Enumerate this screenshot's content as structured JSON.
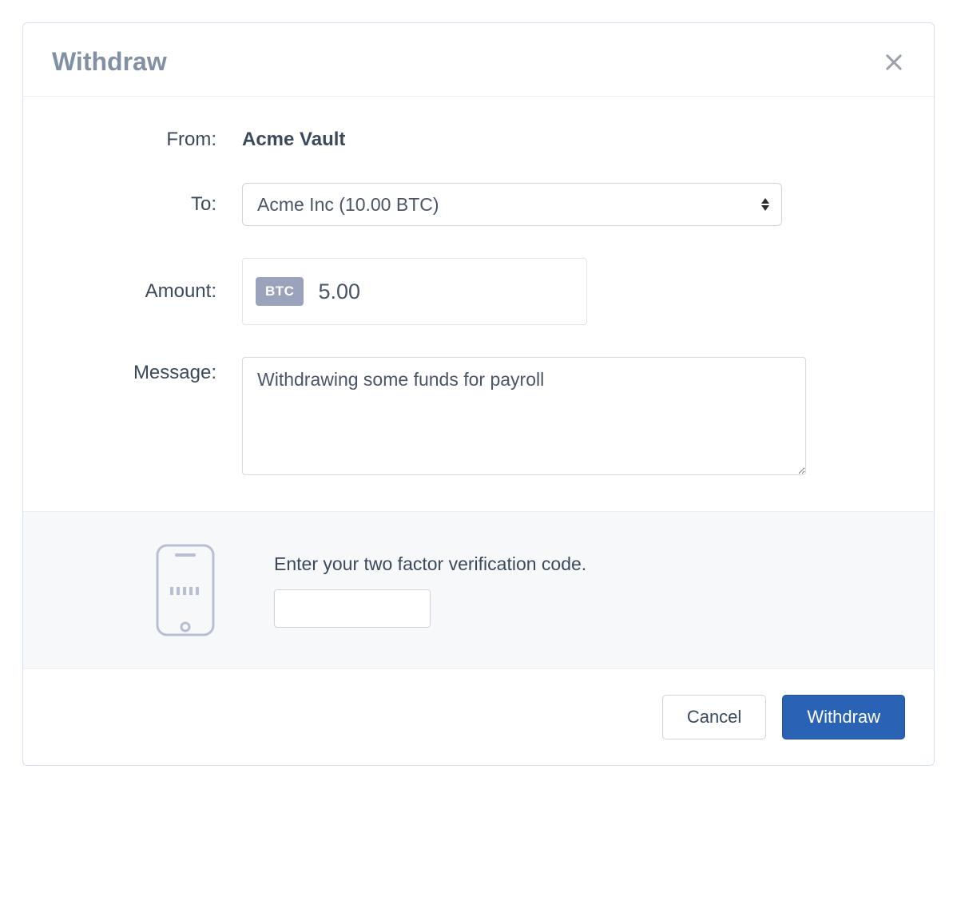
{
  "modal": {
    "title": "Withdraw"
  },
  "form": {
    "from_label": "From:",
    "from_value": "Acme Vault",
    "to_label": "To:",
    "to_selected": "Acme Inc (10.00 BTC)",
    "amount_label": "Amount:",
    "amount_currency": "BTC",
    "amount_value": "5.00",
    "message_label": "Message:",
    "message_value": "Withdrawing some funds for payroll"
  },
  "verification": {
    "label": "Enter your two factor verification code.",
    "value": ""
  },
  "footer": {
    "cancel_label": "Cancel",
    "submit_label": "Withdraw"
  }
}
